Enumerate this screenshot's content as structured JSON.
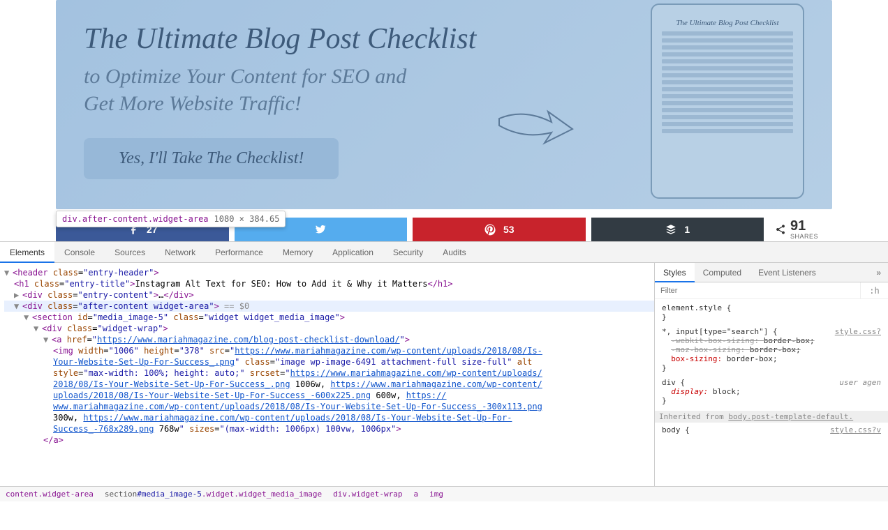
{
  "banner": {
    "title": "The Ultimate Blog Post Checklist",
    "subtitle_line1": "to Optimize Your Content for SEO and",
    "subtitle_line2": "Get More Website Traffic!",
    "cta": "Yes, I'll Take The Checklist!",
    "tablet_title": "The Ultimate Blog Post Checklist"
  },
  "tooltip": {
    "selector": "div.after-content.widget-area",
    "dimensions": "1080 × 384.65"
  },
  "share": {
    "fb_count": "27",
    "pin_count": "53",
    "buf_count": "1",
    "total_num": "91",
    "total_label": "SHARES"
  },
  "devtools": {
    "tabs": [
      "Elements",
      "Console",
      "Sources",
      "Network",
      "Performance",
      "Memory",
      "Application",
      "Security",
      "Audits"
    ],
    "active_tab": "Elements",
    "side_tabs": [
      "Styles",
      "Computed",
      "Event Listeners"
    ],
    "filter_placeholder": "Filter",
    "hov_label": ":h",
    "dom": {
      "header_open": "<header class=\"entry-header\">",
      "h1_text": "Instagram Alt Text for SEO: How to Add it & Why it Matters",
      "entry_content": "<div class=\"entry-content\">…</div>",
      "selected": "<div class=\"after-content widget-area\">",
      "selected_var": "== $0",
      "section": "<section id=\"media_image-5\" class=\"widget widget_media_image\">",
      "widget_wrap": "<div class=\"widget-wrap\">",
      "a_href": "https://www.mariahmagazine.com/blog-post-checklist-download/",
      "img_attrs_pre": "<img width=\"1006\" height=\"378\" src=\"",
      "img_src": "https://www.mariahmagazine.com/wp-content/uploads/2018/08/Is-Your-Website-Set-Up-For-Success_.png",
      "img_class": "\" class=\"image wp-image-6491  attachment-full size-full\" alt",
      "img_style": "style=\"max-width: 100%; height: auto;\" srcset=\"",
      "srcset1": "https://www.mariahmagazine.com/wp-content/uploads/2018/08/Is-Your-Website-Set-Up-For-Success_.png",
      "srcset1_w": " 1006w, ",
      "srcset2": "https://www.mariahmagazine.com/wp-content/uploads/2018/08/Is-Your-Website-Set-Up-For-Success_-600x225.png",
      "srcset2_w": " 600w, ",
      "srcset3": "https://www.mariahmagazine.com/wp-content/uploads/2018/08/Is-Your-Website-Set-Up-For-Success_-300x113.png",
      "srcset3_w": " 300w, ",
      "srcset4": "https://www.mariahmagazine.com/wp-content/uploads/2018/08/Is-Your-Website-Set-Up-For-Success_-768x289.png",
      "srcset4_w": " 768w\"",
      "sizes": " sizes=\"(max-width: 1006px) 100vw, 1006px\">",
      "a_close": "</a>"
    },
    "styles": {
      "rule1_sel": "element.style {",
      "rule2_sel": "*, input[type=\"search\"] {",
      "rule2_origin": "style.css?",
      "rule2_p1": "-webkit-box-sizing:",
      "rule2_v1": "border-box;",
      "rule2_p2": "-moz-box-sizing:",
      "rule2_v2": "border-box;",
      "rule2_p3": "box-sizing:",
      "rule2_v3": "border-box;",
      "rule3_sel": "div {",
      "rule3_origin": "user agen",
      "rule3_p1": "display:",
      "rule3_v1": "block;",
      "inherit_label": "Inherited from ",
      "inherit_sel": "body.post-template-default.",
      "rule4_sel": "body {",
      "rule4_origin": "style.css?v"
    },
    "breadcrumb": {
      "b1": "content.widget-area",
      "b2_tag": "section",
      "b2_id": "#media_image-5",
      "b2_cls": ".widget.widget_media_image",
      "b3": "div.widget-wrap",
      "b4": "a",
      "b5": "img"
    }
  }
}
